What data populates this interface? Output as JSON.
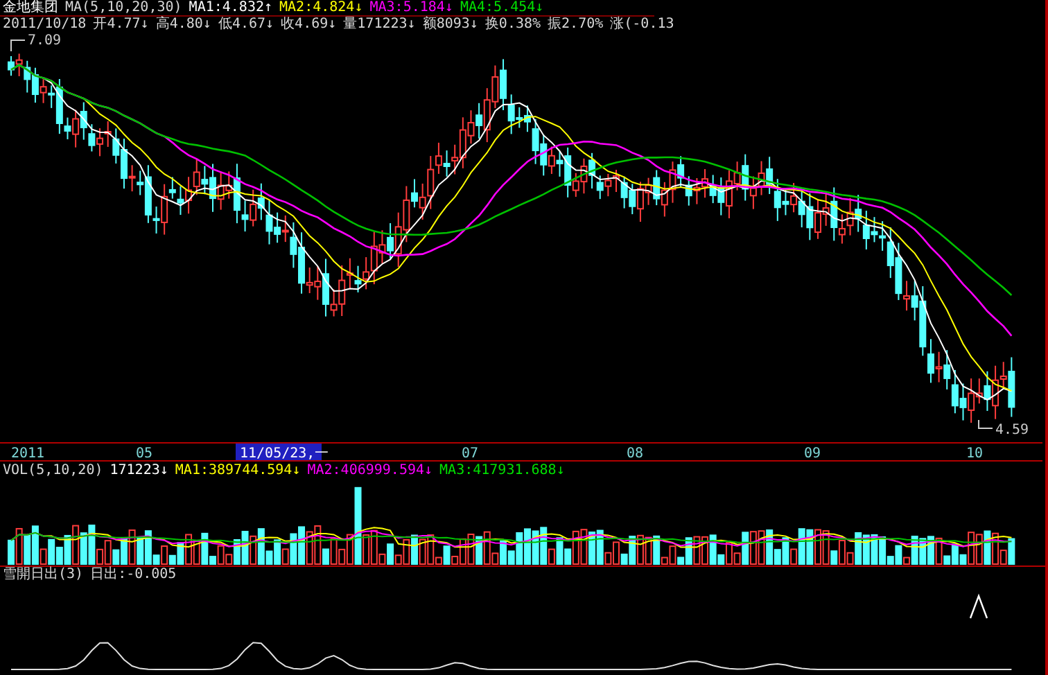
{
  "header": {
    "stock_name": "金地集团",
    "indicator": "MA(5,10,20,30)",
    "mas": [
      {
        "text": "MA1:4.832↑",
        "color": "#ffffff"
      },
      {
        "text": "MA2:4.824↓",
        "color": "#ffff00"
      },
      {
        "text": "MA3:5.184↓",
        "color": "#ff00ff"
      },
      {
        "text": "MA4:5.454↓",
        "color": "#00e000"
      }
    ],
    "quote": [
      "2011/10/18",
      "开4.77↓",
      "高4.80↓",
      "低4.67↓",
      "收4.69↓",
      "量171223↓",
      "额8093↓",
      "换0.38%",
      "振2.70%",
      "涨(-0.13"
    ]
  },
  "price_panel": {
    "high_label": "7.09",
    "low_label": "4.59"
  },
  "time_axis": {
    "labels": [
      "2011",
      "05",
      "07",
      "08",
      "09",
      "10"
    ],
    "cursor_date": "11/05/23,一"
  },
  "volume_panel": {
    "indicator": "VOL(5,10,20)",
    "value": "171223↓",
    "mas": [
      {
        "text": "MA1:389744.594↓",
        "color": "#ffff00"
      },
      {
        "text": "MA2:406999.594↓",
        "color": "#ff00ff"
      },
      {
        "text": "MA3:417931.688↓",
        "color": "#00e000"
      }
    ]
  },
  "indicator_panel": {
    "name": "雪開日出(3)",
    "reading": "日出:-0.005"
  }
}
